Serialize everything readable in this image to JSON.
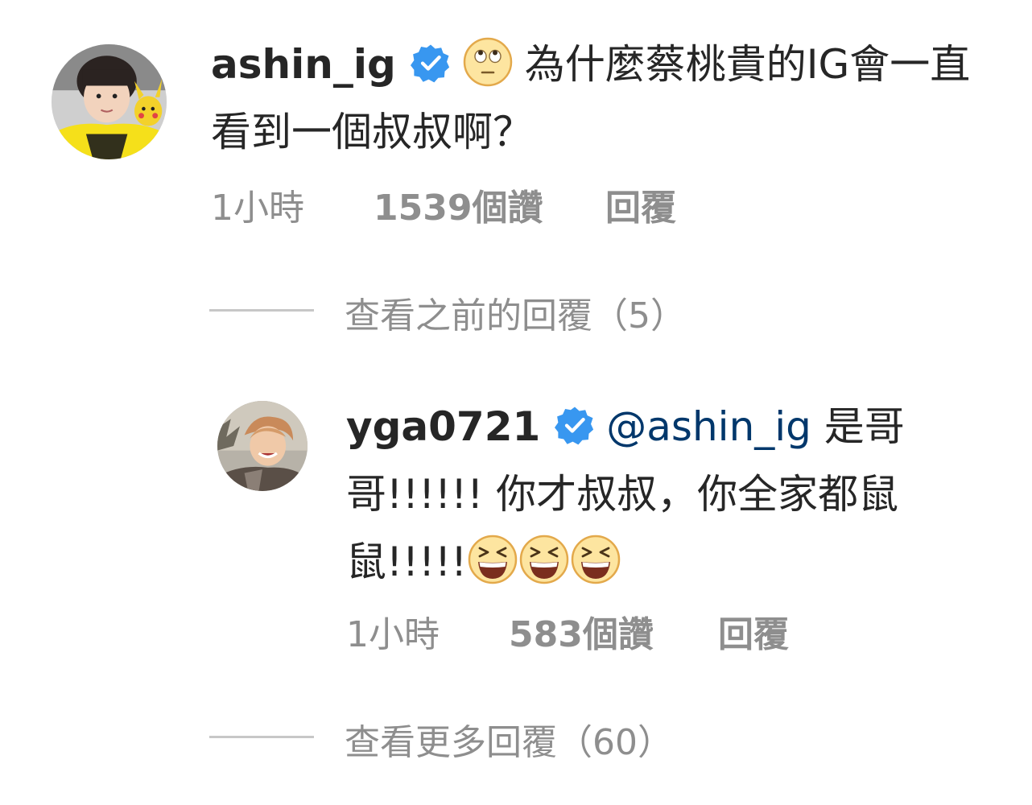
{
  "comments": [
    {
      "username": "ashin_ig",
      "verified": true,
      "emoji_before": "face-with-rolling-eyes-emoji",
      "text": "為什麼蔡桃貴的IG會一直看到一個叔叔啊？",
      "time": "1小時",
      "likes": "1539個讚",
      "reply_label": "回覆"
    },
    {
      "username": "yga0721",
      "verified": true,
      "mention": "@ashin_ig",
      "text": " 是哥哥!!!!!! 你才叔叔，你全家都鼠鼠!!!!!",
      "emoji_after": [
        "grinning-squinting-face-emoji",
        "grinning-squinting-face-emoji",
        "grinning-squinting-face-emoji"
      ],
      "time": "1小時",
      "likes": "583個讚",
      "reply_label": "回覆"
    }
  ],
  "view_previous_replies": "查看之前的回覆（5）",
  "view_more_replies": "查看更多回覆（60）",
  "colors": {
    "text": "#262626",
    "secondary": "#8e8e8e",
    "mention": "#00376b",
    "verified": "#3897f0",
    "divider": "#c7c7c7"
  }
}
